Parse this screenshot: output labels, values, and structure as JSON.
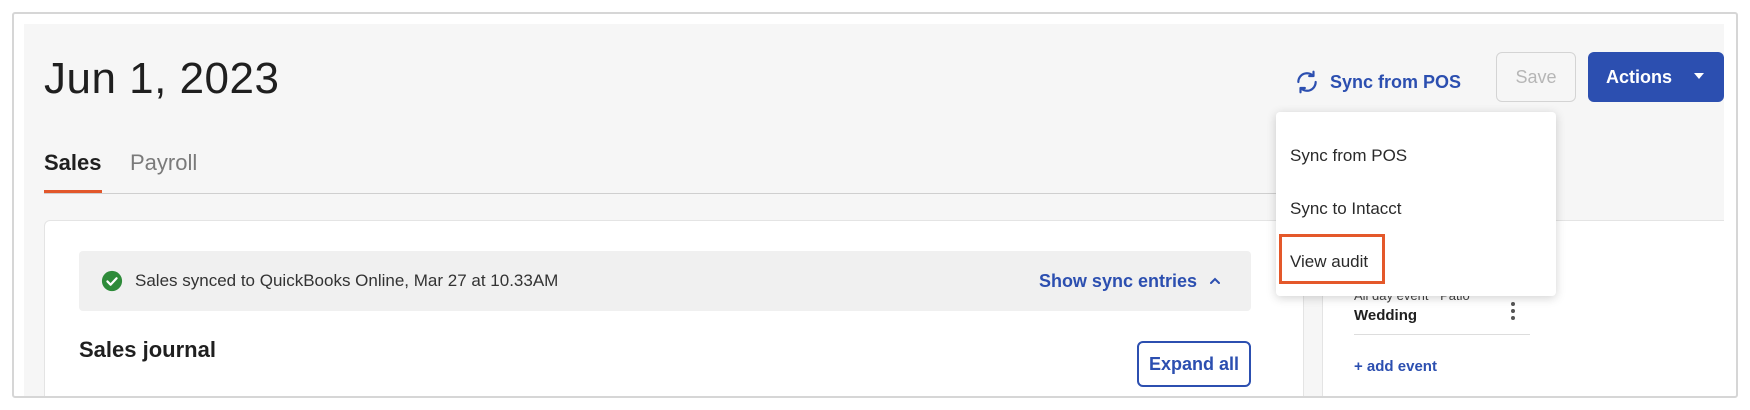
{
  "header": {
    "title": "Jun 1, 2023",
    "sync_link_label": "Sync from POS",
    "save_label": "Save",
    "actions_label": "Actions"
  },
  "tabs": [
    {
      "label": "Sales",
      "active": true
    },
    {
      "label": "Payroll",
      "active": false
    }
  ],
  "sync_banner": {
    "message": "Sales synced to QuickBooks Online, Mar 27 at 10.33AM",
    "toggle_label": "Show sync entries"
  },
  "journal": {
    "title": "Sales journal",
    "expand_label": "Expand all"
  },
  "actions_menu": {
    "items": [
      "Sync from POS",
      "Sync to Intacct",
      "View audit"
    ],
    "highlighted_item": "View audit"
  },
  "events": {
    "type": "All day event",
    "location": "Patio",
    "name": "Wedding",
    "add_label": "+ add event"
  },
  "colors": {
    "primary": "#2c4fb0",
    "accent_tab": "#e2572b",
    "highlight_box": "#e4582a",
    "success": "#2e8b3a"
  },
  "icons": {
    "sync": "sync-icon",
    "check": "check-circle-icon",
    "chevron_up": "chevron-up-icon",
    "caret_down": "caret-down-icon",
    "kebab": "kebab-menu-icon"
  }
}
